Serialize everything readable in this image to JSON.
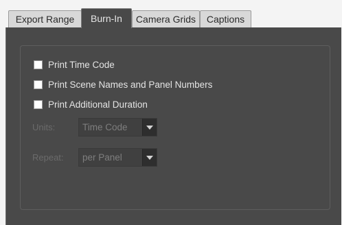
{
  "tabs": [
    {
      "label": "Export Range",
      "active": false
    },
    {
      "label": "Burn-In",
      "active": true
    },
    {
      "label": "Camera Grids",
      "active": false
    },
    {
      "label": "Captions",
      "active": false
    }
  ],
  "checkboxes": [
    {
      "label": "Print Time Code",
      "checked": false
    },
    {
      "label": "Print Scene Names and Panel Numbers",
      "checked": false
    },
    {
      "label": "Print Additional Duration",
      "checked": false
    }
  ],
  "units": {
    "label": "Units:",
    "value": "Time Code",
    "icon": "chevron-down-icon",
    "enabled": false
  },
  "repeat": {
    "label": "Repeat:",
    "value": "per Panel",
    "icon": "chevron-down-icon",
    "enabled": false
  }
}
